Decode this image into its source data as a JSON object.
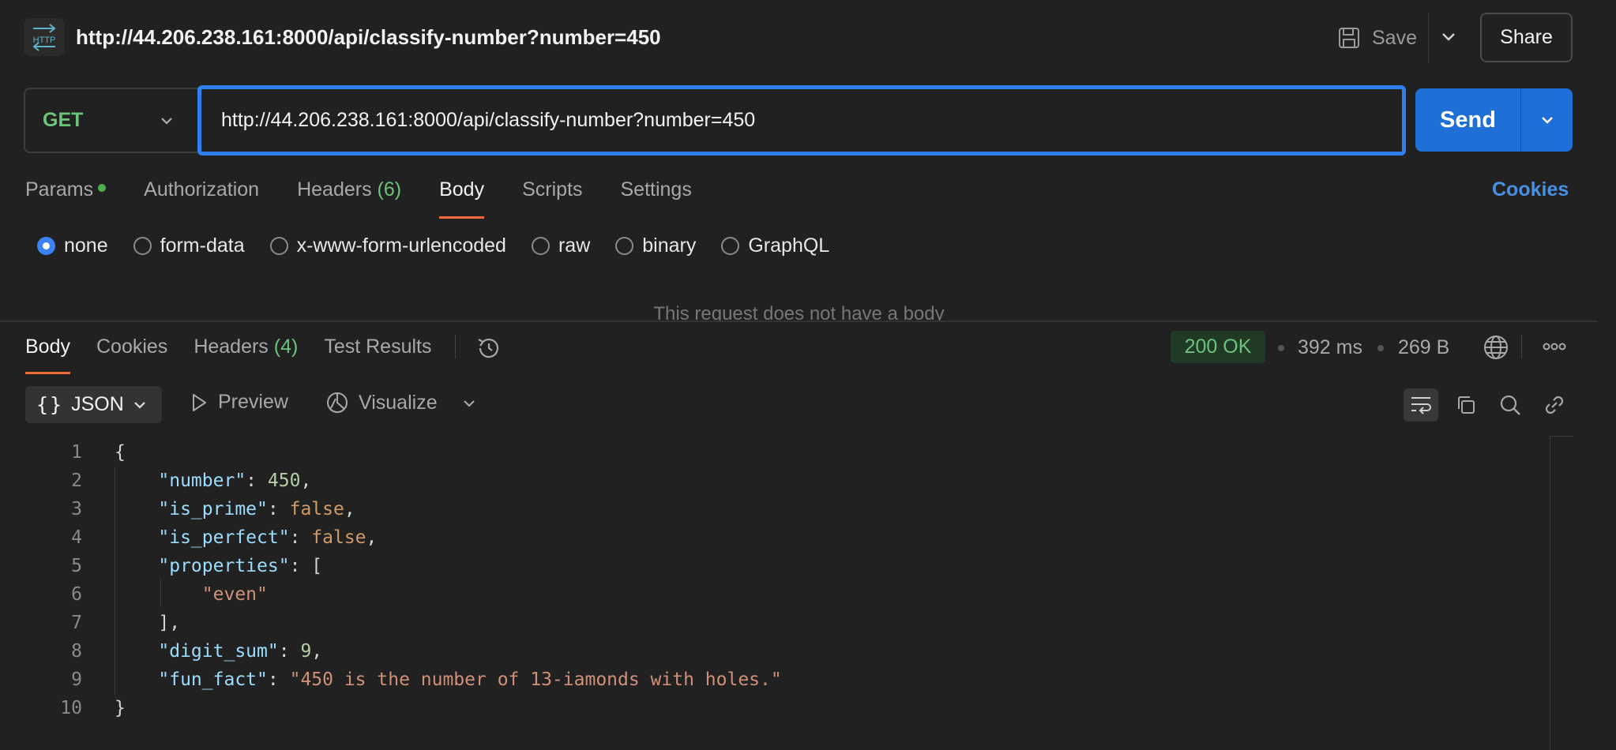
{
  "header": {
    "title": "http://44.206.238.161:8000/api/classify-number?number=450",
    "icon_label": "HTTP",
    "save_label": "Save",
    "share_label": "Share"
  },
  "request": {
    "method": "GET",
    "url": "http://44.206.238.161:8000/api/classify-number?number=450",
    "send_label": "Send"
  },
  "request_tabs": {
    "params": "Params",
    "authorization": "Authorization",
    "headers": "Headers",
    "headers_count": "(6)",
    "body": "Body",
    "scripts": "Scripts",
    "settings": "Settings",
    "cookies": "Cookies",
    "active": "Body"
  },
  "body_types": {
    "options": [
      "none",
      "form-data",
      "x-www-form-urlencoded",
      "raw",
      "binary",
      "GraphQL"
    ],
    "selected": "none",
    "empty_message": "This request does not have a body"
  },
  "response_tabs": {
    "body": "Body",
    "cookies": "Cookies",
    "headers": "Headers",
    "headers_count": "(4)",
    "test_results": "Test Results",
    "active": "Body"
  },
  "response_meta": {
    "status": "200 OK",
    "time": "392 ms",
    "size": "269 B"
  },
  "response_toolbar": {
    "format": "JSON",
    "preview": "Preview",
    "visualize": "Visualize"
  },
  "code_lines": [
    {
      "no": "1",
      "text": "{"
    },
    {
      "no": "2",
      "text": "    \"number\": 450,"
    },
    {
      "no": "3",
      "text": "    \"is_prime\": false,"
    },
    {
      "no": "4",
      "text": "    \"is_perfect\": false,"
    },
    {
      "no": "5",
      "text": "    \"properties\": ["
    },
    {
      "no": "6",
      "text": "        \"even\""
    },
    {
      "no": "7",
      "text": "    ],"
    },
    {
      "no": "8",
      "text": "    \"digit_sum\": 9,"
    },
    {
      "no": "9",
      "text": "    \"fun_fact\": \"450 is the number of 13-iamonds with holes.\""
    },
    {
      "no": "10",
      "text": "}"
    }
  ],
  "colors": {
    "background": "#212121",
    "accent": "#2f80ed",
    "send": "#1f6fd6",
    "method": "#6cc37b",
    "tab_underline": "#f26b3a",
    "link": "#4a90e2"
  }
}
